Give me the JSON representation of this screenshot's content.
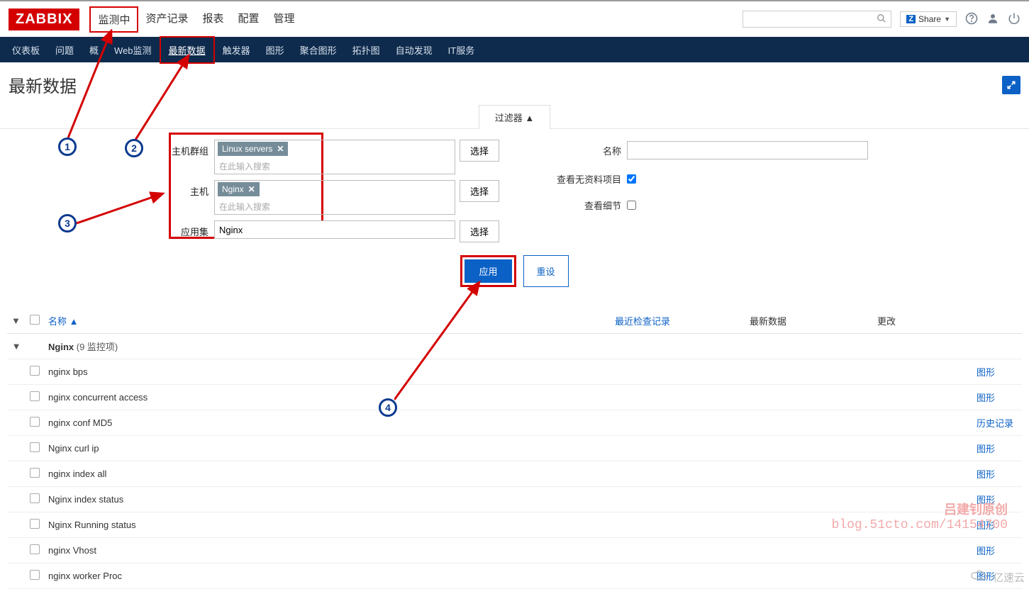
{
  "logo": "ZABBIX",
  "topnav": [
    "监测中",
    "资产记录",
    "报表",
    "配置",
    "管理"
  ],
  "share_label": "Share",
  "subnav": [
    "仪表板",
    "问题",
    "概",
    "Web监测",
    "最新数据",
    "触发器",
    "图形",
    "聚合图形",
    "拓扑图",
    "自动发现",
    "IT服务"
  ],
  "page_title": "最新数据",
  "filter_tab": "过滤器 ▲",
  "filter": {
    "hostgroup_label": "主机群组",
    "hostgroup_tag": "Linux servers",
    "search_placeholder": "在此输入搜索",
    "host_label": "主机",
    "host_tag": "Nginx",
    "appset_label": "应用集",
    "appset_value": "Nginx",
    "select_btn": "选择",
    "name_label": "名称",
    "show_empty_label": "查看无资料项目",
    "show_details_label": "查看细节",
    "apply_btn": "应用",
    "reset_btn": "重设"
  },
  "table": {
    "col_name": "名称",
    "col_lastcheck": "最近检查记录",
    "col_lastdata": "最新数据",
    "col_change": "更改",
    "group_name": "Nginx",
    "group_count": "(9 监控项)",
    "rows": [
      {
        "name": "nginx bps",
        "action": "图形"
      },
      {
        "name": "nginx concurrent access",
        "action": "图形"
      },
      {
        "name": "nginx conf MD5",
        "action": "历史记录"
      },
      {
        "name": "Nginx curl ip",
        "action": "图形"
      },
      {
        "name": "nginx index all",
        "action": "图形"
      },
      {
        "name": "Nginx index status",
        "action": "图形"
      },
      {
        "name": "Nginx Running status",
        "action": "图形"
      },
      {
        "name": "nginx Vhost",
        "action": "图形"
      },
      {
        "name": "nginx worker Proc",
        "action": "图形"
      }
    ]
  },
  "callouts": {
    "c1": "1",
    "c2": "2",
    "c3": "3",
    "c4": "4"
  },
  "watermark1_line1": "吕建钊原创",
  "watermark1_line2": "blog.51cto.com/14154700",
  "watermark2": "亿速云"
}
